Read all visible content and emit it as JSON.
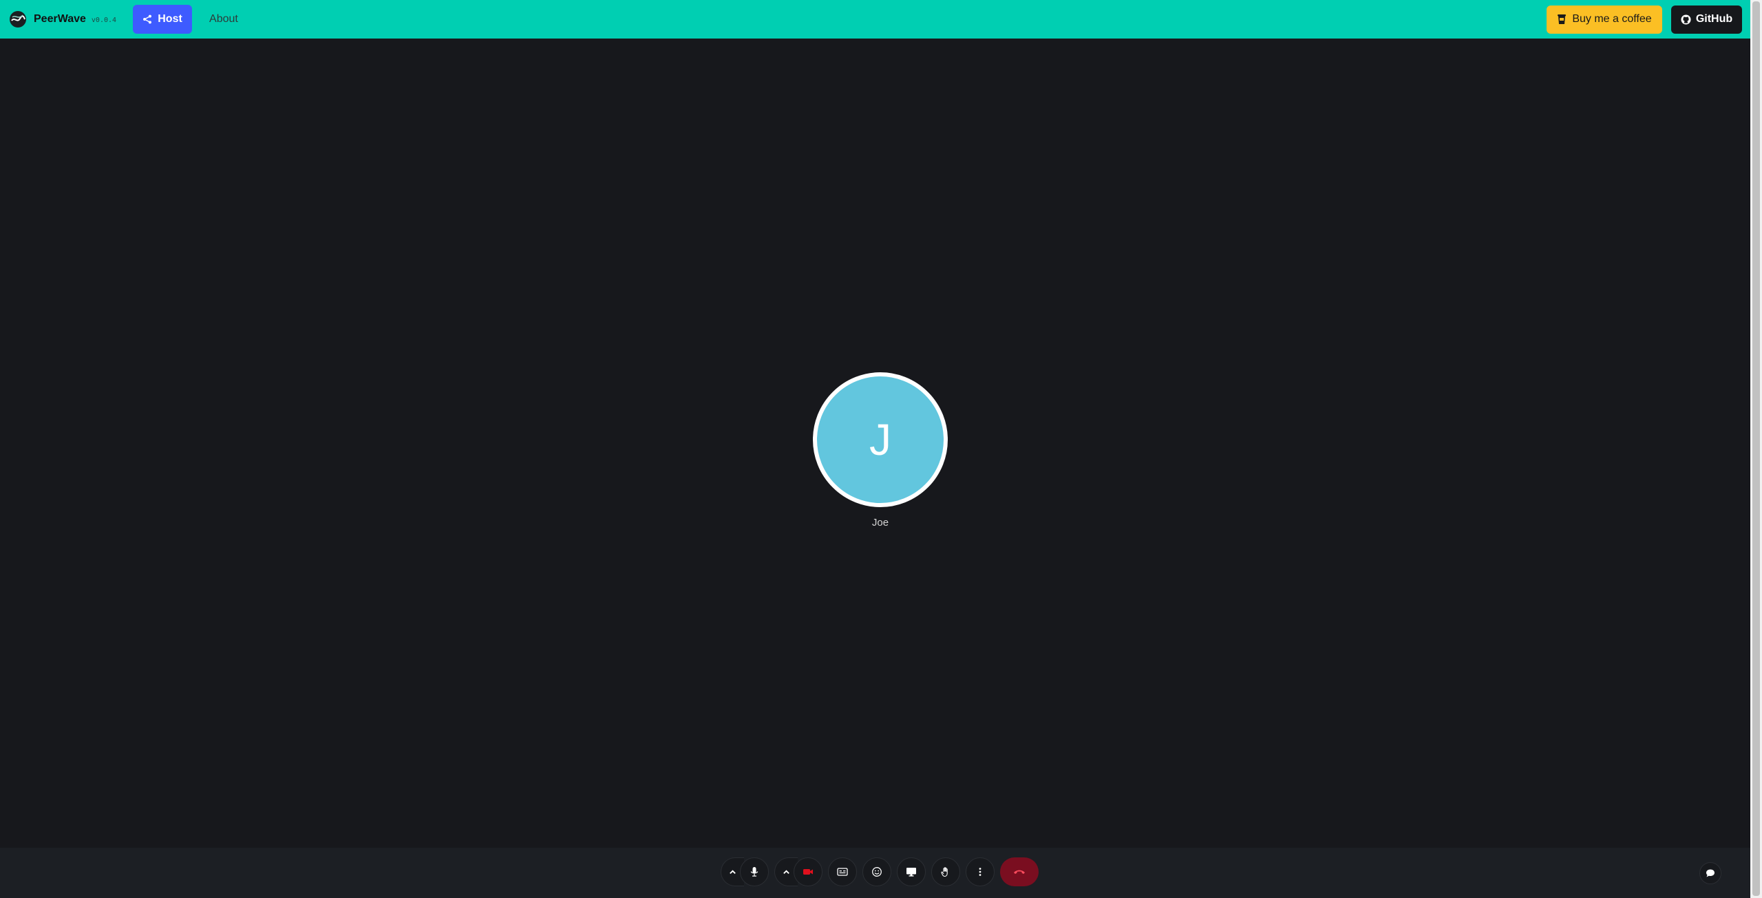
{
  "navbar": {
    "brand_name": "PeerWave",
    "brand_version": "v0.0.4",
    "host_label": "Host",
    "about_label": "About",
    "coffee_label": "Buy me a coffee",
    "github_label": "GitHub"
  },
  "stage": {
    "participant": {
      "initial": "J",
      "name": "Joe",
      "avatar_color": "#62c6de"
    }
  },
  "controls": [
    {
      "name": "mic-options",
      "icon": "chevron-up-icon"
    },
    {
      "name": "microphone",
      "icon": "microphone-icon"
    },
    {
      "name": "camera-options",
      "icon": "chevron-up-icon"
    },
    {
      "name": "camera",
      "icon": "video-icon",
      "state": "off"
    },
    {
      "name": "captions",
      "icon": "closed-captions-icon"
    },
    {
      "name": "reactions",
      "icon": "smiley-icon"
    },
    {
      "name": "share-screen",
      "icon": "monitor-icon"
    },
    {
      "name": "raise-hand",
      "icon": "hand-icon"
    },
    {
      "name": "more-options",
      "icon": "vertical-dots-icon"
    },
    {
      "name": "hang-up",
      "icon": "phone-hangup-icon"
    }
  ],
  "colors": {
    "navbar": "#00cfb2",
    "host_button": "#3e5bff",
    "coffee_button": "#fbbf24",
    "github_button": "#16181b",
    "camera_off": "#e0101d",
    "hangup": "#7a0e20",
    "background": "#17181c"
  }
}
